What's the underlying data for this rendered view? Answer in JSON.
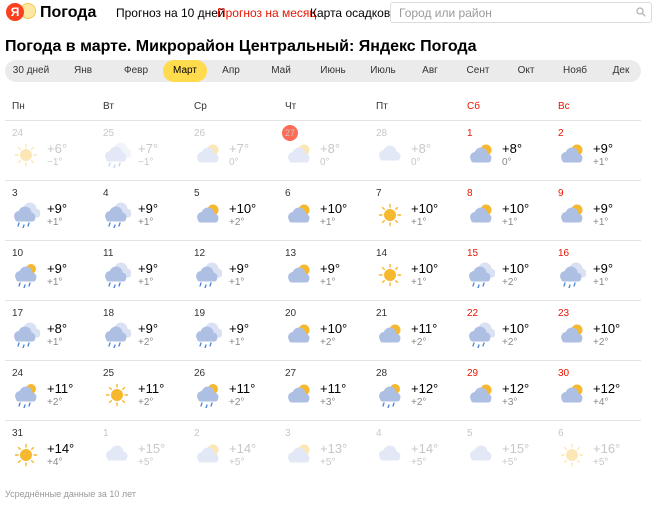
{
  "header": {
    "logo_letter": "Я",
    "logo_text": "Погода",
    "nav": [
      {
        "label": "Прогноз на 10 дней",
        "active": false
      },
      {
        "label": "Прогноз на месяц",
        "active": true
      },
      {
        "label": "Карта осадков",
        "active": false
      }
    ],
    "search_placeholder": "Город или район"
  },
  "page_title": "Погода в марте. Микрорайон Центральный: Яндекс Погода",
  "tabs": [
    "30 дней",
    "Янв",
    "Февр",
    "Март",
    "Апр",
    "Май",
    "Июнь",
    "Июль",
    "Авг",
    "Сент",
    "Окт",
    "Нояб",
    "Дек"
  ],
  "selected_tab": "Март",
  "weekdays": [
    "Пн",
    "Вт",
    "Ср",
    "Чт",
    "Пт",
    "Сб",
    "Вс"
  ],
  "weeks": [
    [
      {
        "date": "24",
        "icon": "sun-icon",
        "max": "+6°",
        "min": "−1°",
        "faded": true
      },
      {
        "date": "25",
        "icon": "cloud-rain-icon",
        "max": "+7°",
        "min": "−1°",
        "faded": true
      },
      {
        "date": "26",
        "icon": "cloud-sun-icon",
        "max": "+7°",
        "min": "0°",
        "faded": true
      },
      {
        "date": "27",
        "icon": "cloud-sun-icon",
        "max": "+8°",
        "min": "0°",
        "faded": true,
        "today": true
      },
      {
        "date": "28",
        "icon": "cloud-icon",
        "max": "+8°",
        "min": "0°",
        "faded": true
      },
      {
        "date": "1",
        "icon": "cloud-sun-icon",
        "max": "+8°",
        "min": "0°"
      },
      {
        "date": "2",
        "icon": "cloud-sun-icon",
        "max": "+9°",
        "min": "+1°"
      }
    ],
    [
      {
        "date": "3",
        "icon": "cloud-rain-icon",
        "max": "+9°",
        "min": "+1°"
      },
      {
        "date": "4",
        "icon": "cloud-rain-icon",
        "max": "+9°",
        "min": "+1°"
      },
      {
        "date": "5",
        "icon": "cloud-sun-icon",
        "max": "+10°",
        "min": "+2°"
      },
      {
        "date": "6",
        "icon": "cloud-sun-icon",
        "max": "+10°",
        "min": "+1°"
      },
      {
        "date": "7",
        "icon": "sun-icon",
        "max": "+10°",
        "min": "+1°"
      },
      {
        "date": "8",
        "icon": "cloud-sun-icon",
        "max": "+10°",
        "min": "+1°"
      },
      {
        "date": "9",
        "icon": "cloud-sun-icon",
        "max": "+9°",
        "min": "+1°"
      }
    ],
    [
      {
        "date": "10",
        "icon": "cloud-sun-rain-icon",
        "max": "+9°",
        "min": "+1°"
      },
      {
        "date": "11",
        "icon": "cloud-rain-icon",
        "max": "+9°",
        "min": "+1°"
      },
      {
        "date": "12",
        "icon": "cloud-rain-icon",
        "max": "+9°",
        "min": "+1°"
      },
      {
        "date": "13",
        "icon": "cloud-sun-icon",
        "max": "+9°",
        "min": "+1°"
      },
      {
        "date": "14",
        "icon": "sun-icon",
        "max": "+10°",
        "min": "+1°"
      },
      {
        "date": "15",
        "icon": "cloud-rain-icon",
        "max": "+10°",
        "min": "+2°"
      },
      {
        "date": "16",
        "icon": "cloud-rain-icon",
        "max": "+9°",
        "min": "+1°"
      }
    ],
    [
      {
        "date": "17",
        "icon": "cloud-rain-icon",
        "max": "+8°",
        "min": "+1°"
      },
      {
        "date": "18",
        "icon": "cloud-rain-icon",
        "max": "+9°",
        "min": "+2°"
      },
      {
        "date": "19",
        "icon": "cloud-rain-icon",
        "max": "+9°",
        "min": "+1°"
      },
      {
        "date": "20",
        "icon": "cloud-sun-icon",
        "max": "+10°",
        "min": "+2°"
      },
      {
        "date": "21",
        "icon": "cloud-sun-icon",
        "max": "+11°",
        "min": "+2°"
      },
      {
        "date": "22",
        "icon": "cloud-rain-icon",
        "max": "+10°",
        "min": "+2°"
      },
      {
        "date": "23",
        "icon": "cloud-sun-icon",
        "max": "+10°",
        "min": "+2°"
      }
    ],
    [
      {
        "date": "24",
        "icon": "cloud-sun-rain-icon",
        "max": "+11°",
        "min": "+2°"
      },
      {
        "date": "25",
        "icon": "sun-icon",
        "max": "+11°",
        "min": "+2°"
      },
      {
        "date": "26",
        "icon": "cloud-sun-rain-icon",
        "max": "+11°",
        "min": "+2°"
      },
      {
        "date": "27",
        "icon": "cloud-sun-icon",
        "max": "+11°",
        "min": "+3°"
      },
      {
        "date": "28",
        "icon": "cloud-sun-rain-icon",
        "max": "+12°",
        "min": "+2°"
      },
      {
        "date": "29",
        "icon": "cloud-sun-icon",
        "max": "+12°",
        "min": "+3°"
      },
      {
        "date": "30",
        "icon": "cloud-sun-icon",
        "max": "+12°",
        "min": "+4°"
      }
    ],
    [
      {
        "date": "31",
        "icon": "sun-icon",
        "max": "+14°",
        "min": "+4°"
      },
      {
        "date": "1",
        "icon": "cloud-icon",
        "max": "+15°",
        "min": "+5°",
        "faded": true
      },
      {
        "date": "2",
        "icon": "cloud-sun-icon",
        "max": "+14°",
        "min": "+5°",
        "faded": true
      },
      {
        "date": "3",
        "icon": "cloud-sun-icon",
        "max": "+13°",
        "min": "+5°",
        "faded": true
      },
      {
        "date": "4",
        "icon": "cloud-icon",
        "max": "+14°",
        "min": "+5°",
        "faded": true
      },
      {
        "date": "5",
        "icon": "cloud-icon",
        "max": "+15°",
        "min": "+5°",
        "faded": true
      },
      {
        "date": "6",
        "icon": "sun-icon",
        "max": "+16°",
        "min": "+5°",
        "faded": true
      }
    ]
  ],
  "footnote": "Усреднённые данные за 10 лет",
  "colors": {
    "accent_red": "#e61400",
    "selected_tab": "#ffdb4d",
    "today_badge": "#ff6b56",
    "cloud": "#aebfe4",
    "sun": "#f5b82e"
  }
}
